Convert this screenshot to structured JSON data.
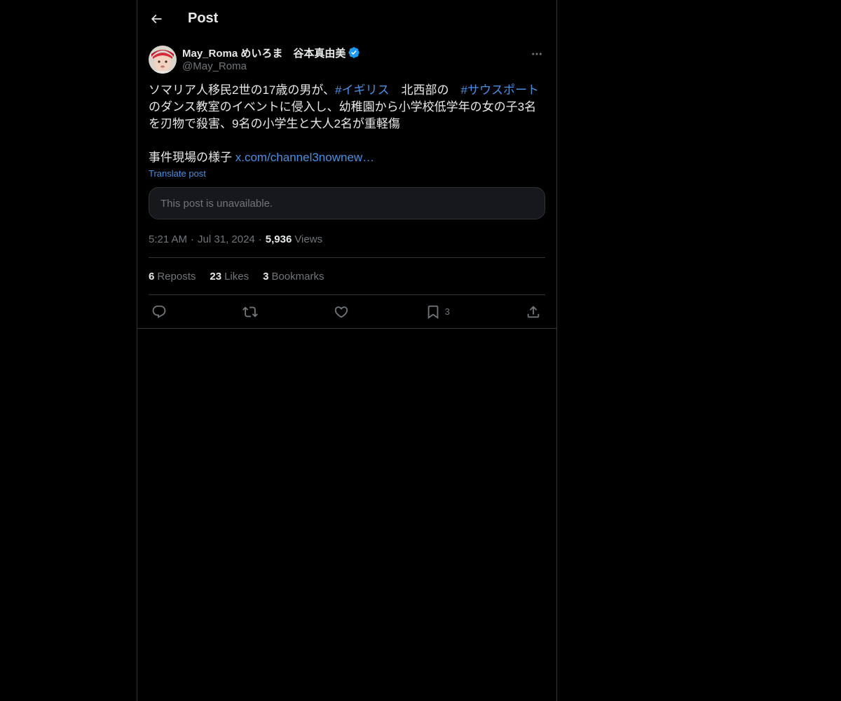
{
  "header": {
    "title": "Post"
  },
  "author": {
    "display_name": "May_Roma めいろま　谷本真由美",
    "handle": "@May_Roma"
  },
  "post": {
    "line1_text_a": "ソマリア人移民2世の17歳の男が、",
    "hashtag1": "#イギリス",
    "line1_text_b": "　北西部の　",
    "hashtag2": "#サウスポート",
    "line2_text": "のダンス教室のイベントに侵入し、幼稚園から小学校低学年の女の子3名を刃物で殺害、9名の小学生と大人2名が重軽傷",
    "line3_text": "事件現場の様子 ",
    "link_text": "x.com/channel3nownew…",
    "translate_label": "Translate post",
    "unavailable_text": "This post is unavailable."
  },
  "meta": {
    "time": "5:21 AM",
    "date": "Jul 31, 2024",
    "views_count": "5,936",
    "views_label": "Views",
    "separator": "·"
  },
  "stats": {
    "reposts_count": "6",
    "reposts_label": "Reposts",
    "likes_count": "23",
    "likes_label": "Likes",
    "bookmarks_count": "3",
    "bookmarks_label": "Bookmarks"
  },
  "actions": {
    "bookmark_count": "3"
  },
  "colors": {
    "background": "#000000",
    "text": "#e7e9ea",
    "muted": "#71767b",
    "accent": "#4a90e2",
    "verified": "#1d9bf0",
    "border": "#2f3336"
  },
  "icons": {
    "back": "arrow-left-icon",
    "verified": "verified-badge-icon",
    "more": "more-horizontal-icon",
    "reply": "reply-icon",
    "repost": "repost-icon",
    "like": "heart-icon",
    "bookmark": "bookmark-icon",
    "share": "share-icon"
  }
}
